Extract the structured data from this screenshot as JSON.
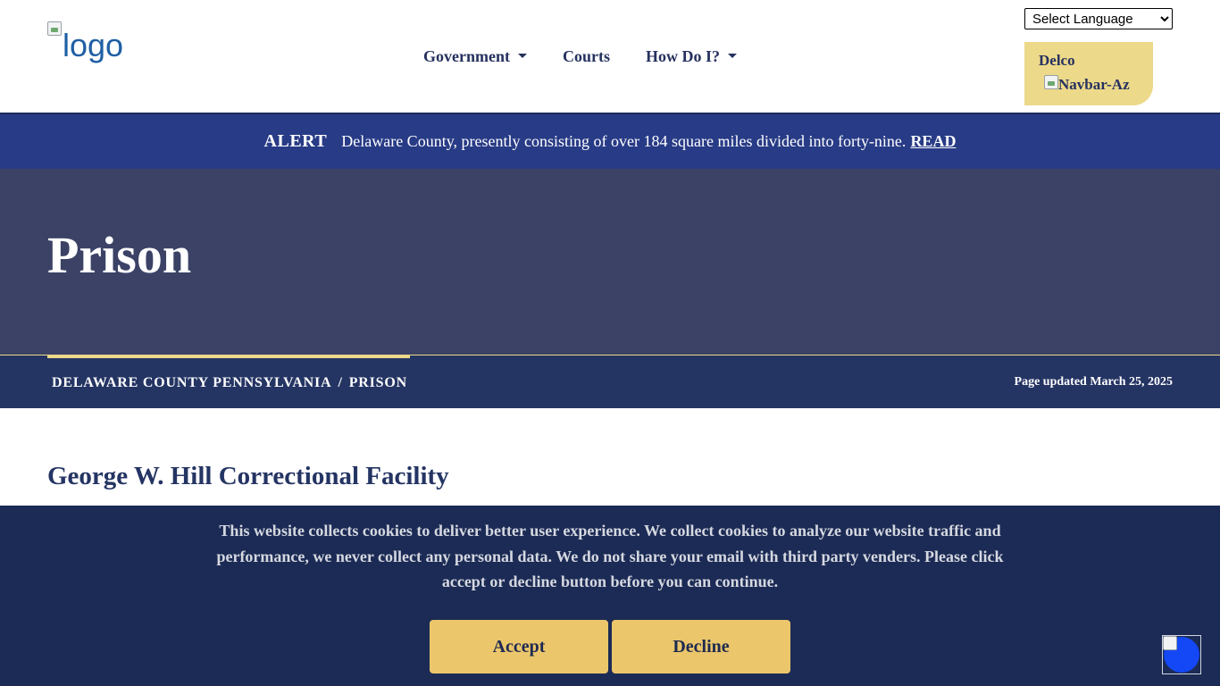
{
  "header": {
    "logo_alt": "logo",
    "nav": [
      {
        "label": "Government",
        "has_dropdown": true
      },
      {
        "label": "Courts",
        "has_dropdown": false
      },
      {
        "label": "How Do I?",
        "has_dropdown": true
      }
    ],
    "language_select": {
      "selected": "Select Language"
    },
    "delco_box": {
      "label": "Delco",
      "image_alt": "Navbar-Az"
    }
  },
  "alert": {
    "label": "ALERT",
    "text": "Delaware County, presently consisting of over 184 square miles divided into forty-nine.",
    "link": "READ"
  },
  "hero": {
    "title": "Prison"
  },
  "breadcrumb": {
    "items": [
      "DELAWARE COUNTY PENNSYLVANIA",
      "PRISON"
    ],
    "separator": "/",
    "updated": "Page updated March 25, 2025"
  },
  "content": {
    "heading": "George W. Hill Correctional Facility"
  },
  "cookie_banner": {
    "text": "This website collects cookies to deliver better user experience. We collect cookies to analyze our website traffic and performance, we never collect any personal data. We do not share your email with third party venders. Please click accept or decline button before you can continue.",
    "accept_label": "Accept",
    "decline_label": "Decline"
  },
  "colors": {
    "navy": "#243463",
    "alert_blue": "#283b86",
    "hero_slate": "#3b4266",
    "gold": "#edd98a",
    "button_gold": "#ecc66b",
    "cookie_bg": "#1c2b55",
    "a11y_blue": "#1447f5"
  },
  "icons": {
    "broken_image": "broken-image-icon",
    "dropdown_caret": "chevron-down-icon",
    "accessibility": "accessibility-icon"
  }
}
